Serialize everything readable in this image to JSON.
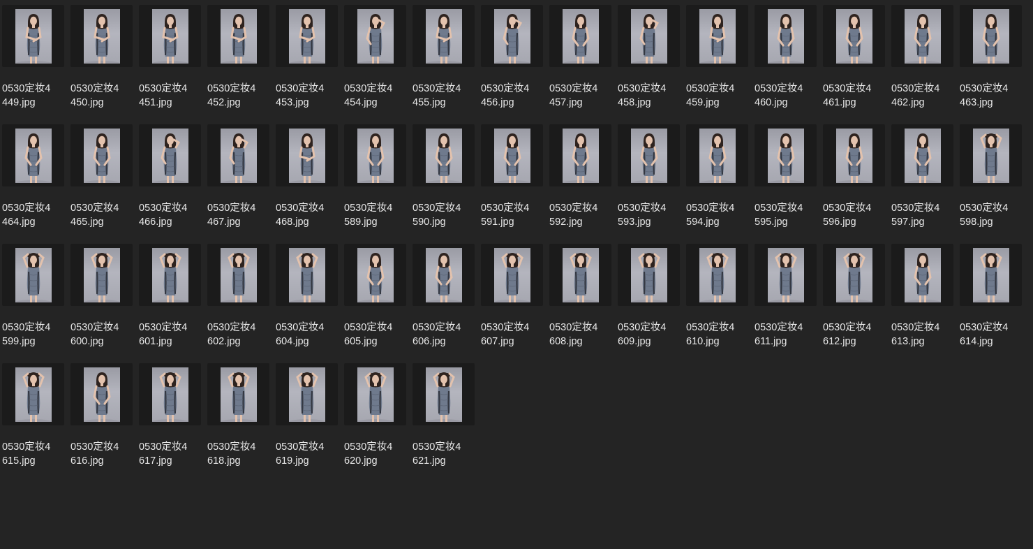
{
  "window": {
    "view": "icon-grid"
  },
  "files": [
    {
      "name_line1": "0530定妆4",
      "name_line2": "449.jpg",
      "pose": "arm-cross"
    },
    {
      "name_line1": "0530定妆4",
      "name_line2": "450.jpg",
      "pose": "arm-cross"
    },
    {
      "name_line1": "0530定妆4",
      "name_line2": "451.jpg",
      "pose": "arm-cross"
    },
    {
      "name_line1": "0530定妆4",
      "name_line2": "452.jpg",
      "pose": "arm-cross"
    },
    {
      "name_line1": "0530定妆4",
      "name_line2": "453.jpg",
      "pose": "arm-cross"
    },
    {
      "name_line1": "0530定妆4",
      "name_line2": "454.jpg",
      "pose": "hand-hair"
    },
    {
      "name_line1": "0530定妆4",
      "name_line2": "455.jpg",
      "pose": "arm-cross"
    },
    {
      "name_line1": "0530定妆4",
      "name_line2": "456.jpg",
      "pose": "hand-chin"
    },
    {
      "name_line1": "0530定妆4",
      "name_line2": "457.jpg",
      "pose": "side"
    },
    {
      "name_line1": "0530定妆4",
      "name_line2": "458.jpg",
      "pose": "hand-chin"
    },
    {
      "name_line1": "0530定妆4",
      "name_line2": "459.jpg",
      "pose": "arm-cross"
    },
    {
      "name_line1": "0530定妆4",
      "name_line2": "460.jpg",
      "pose": "side"
    },
    {
      "name_line1": "0530定妆4",
      "name_line2": "461.jpg",
      "pose": "side"
    },
    {
      "name_line1": "0530定妆4",
      "name_line2": "462.jpg",
      "pose": "side"
    },
    {
      "name_line1": "0530定妆4",
      "name_line2": "463.jpg",
      "pose": "side"
    },
    {
      "name_line1": "0530定妆4",
      "name_line2": "464.jpg",
      "pose": "side"
    },
    {
      "name_line1": "0530定妆4",
      "name_line2": "465.jpg",
      "pose": "side"
    },
    {
      "name_line1": "0530定妆4",
      "name_line2": "466.jpg",
      "pose": "hand-hair"
    },
    {
      "name_line1": "0530定妆4",
      "name_line2": "467.jpg",
      "pose": "hand-hair"
    },
    {
      "name_line1": "0530定妆4",
      "name_line2": "468.jpg",
      "pose": "arm-cross"
    },
    {
      "name_line1": "0530定妆4",
      "name_line2": "589.jpg",
      "pose": "front"
    },
    {
      "name_line1": "0530定妆4",
      "name_line2": "590.jpg",
      "pose": "front"
    },
    {
      "name_line1": "0530定妆4",
      "name_line2": "591.jpg",
      "pose": "front"
    },
    {
      "name_line1": "0530定妆4",
      "name_line2": "592.jpg",
      "pose": "front"
    },
    {
      "name_line1": "0530定妆4",
      "name_line2": "593.jpg",
      "pose": "front"
    },
    {
      "name_line1": "0530定妆4",
      "name_line2": "594.jpg",
      "pose": "front"
    },
    {
      "name_line1": "0530定妆4",
      "name_line2": "595.jpg",
      "pose": "front"
    },
    {
      "name_line1": "0530定妆4",
      "name_line2": "596.jpg",
      "pose": "front"
    },
    {
      "name_line1": "0530定妆4",
      "name_line2": "597.jpg",
      "pose": "front"
    },
    {
      "name_line1": "0530定妆4",
      "name_line2": "598.jpg",
      "pose": "hands-up"
    },
    {
      "name_line1": "0530定妆4",
      "name_line2": "599.jpg",
      "pose": "hands-up"
    },
    {
      "name_line1": "0530定妆4",
      "name_line2": "600.jpg",
      "pose": "hands-up"
    },
    {
      "name_line1": "0530定妆4",
      "name_line2": "601.jpg",
      "pose": "hands-up"
    },
    {
      "name_line1": "0530定妆4",
      "name_line2": "602.jpg",
      "pose": "hands-up"
    },
    {
      "name_line1": "0530定妆4",
      "name_line2": "604.jpg",
      "pose": "hands-up"
    },
    {
      "name_line1": "0530定妆4",
      "name_line2": "605.jpg",
      "pose": "front"
    },
    {
      "name_line1": "0530定妆4",
      "name_line2": "606.jpg",
      "pose": "side"
    },
    {
      "name_line1": "0530定妆4",
      "name_line2": "607.jpg",
      "pose": "hands-up"
    },
    {
      "name_line1": "0530定妆4",
      "name_line2": "608.jpg",
      "pose": "hands-up"
    },
    {
      "name_line1": "0530定妆4",
      "name_line2": "609.jpg",
      "pose": "hands-up"
    },
    {
      "name_line1": "0530定妆4",
      "name_line2": "610.jpg",
      "pose": "hands-up"
    },
    {
      "name_line1": "0530定妆4",
      "name_line2": "611.jpg",
      "pose": "hands-up"
    },
    {
      "name_line1": "0530定妆4",
      "name_line2": "612.jpg",
      "pose": "hands-up"
    },
    {
      "name_line1": "0530定妆4",
      "name_line2": "613.jpg",
      "pose": "front"
    },
    {
      "name_line1": "0530定妆4",
      "name_line2": "614.jpg",
      "pose": "hands-up"
    },
    {
      "name_line1": "0530定妆4",
      "name_line2": "615.jpg",
      "pose": "hands-up"
    },
    {
      "name_line1": "0530定妆4",
      "name_line2": "616.jpg",
      "pose": "front"
    },
    {
      "name_line1": "0530定妆4",
      "name_line2": "617.jpg",
      "pose": "hands-up"
    },
    {
      "name_line1": "0530定妆4",
      "name_line2": "618.jpg",
      "pose": "hands-up"
    },
    {
      "name_line1": "0530定妆4",
      "name_line2": "619.jpg",
      "pose": "hands-up"
    },
    {
      "name_line1": "0530定妆4",
      "name_line2": "620.jpg",
      "pose": "hands-up"
    },
    {
      "name_line1": "0530定妆4",
      "name_line2": "621.jpg",
      "pose": "hands-up"
    }
  ],
  "colors": {
    "background": "#242424",
    "thumb_frame": "#1b1b1b",
    "label_text": "#e8e8e8",
    "dress": "#6f7a8d",
    "backdrop": "#a9aab3",
    "hair": "#2e231f",
    "skin": "#e3c2ad"
  }
}
